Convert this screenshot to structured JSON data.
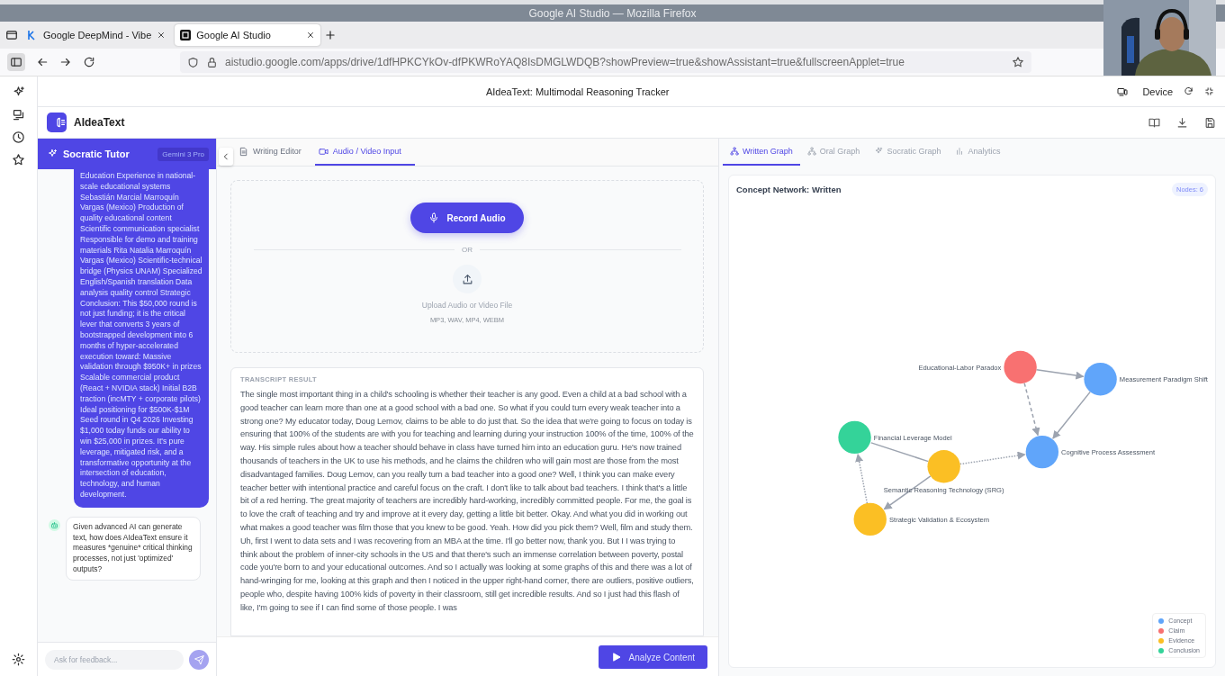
{
  "browser": {
    "window_title": "Google AI Studio — Mozilla Firefox",
    "tabs": [
      {
        "label": "Google DeepMind - Vibe",
        "selected": false
      },
      {
        "label": "Google AI Studio",
        "selected": true
      }
    ],
    "url": "aistudio.google.com/apps/drive/1dfHPKCYkOv-dfPKWRoYAQ8IsDMGLWDQB?showPreview=true&showAssistant=true&fullscreenApplet=true"
  },
  "applet": {
    "title": "AIdeaText: Multimodal Reasoning Tracker",
    "device_label": "Device"
  },
  "app": {
    "name": "AIdeaText"
  },
  "tutor": {
    "title": "Socratic Tutor",
    "model": "Gemini 3 Pro",
    "messages": [
      {
        "kind": "user",
        "text": "Education Experience in national-scale educational systems Sebastián Marcial Marroquín Vargas (Mexico) Production of quality educational content Scientific communication specialist Responsible for demo and training materials Rita Natalia Marroquín Vargas (Mexico) Scientific-technical bridge (Physics UNAM) Specialized English/Spanish translation Data analysis quality control Strategic Conclusion: This $50,000 round is not just funding; it is the critical lever that converts 3 years of bootstrapped development into 6 months of hyper-accelerated execution toward: Massive validation through $950K+ in prizes Scalable commercial product (React + NVIDIA stack) Initial B2B traction (incMTY + corporate pilots) Ideal positioning for $500K-$1M Seed round in Q4 2026 Investing $1,000 today funds our ability to win $25,000 in prizes. It's pure leverage, mitigated risk, and a transformative opportunity at the intersection of education, technology, and human development."
      },
      {
        "kind": "assistant",
        "text": "Given advanced AI can generate text, how does AIdeaText ensure it measures *genuine* critical thinking processes, not just 'optimized' outputs?"
      }
    ],
    "input_placeholder": "Ask for feedback..."
  },
  "input_tabs": [
    {
      "label": "Writing Editor",
      "selected": false
    },
    {
      "label": "Audio / Video Input",
      "selected": true
    }
  ],
  "recorder": {
    "record_label": "Record Audio",
    "divider": "OR",
    "upload_label": "Upload Audio or Video File",
    "formats": "MP3, WAV, MP4, WEBM"
  },
  "transcript": {
    "heading": "TRANSCRIPT RESULT",
    "text": "The single most important thing in a child's schooling is whether their teacher is any good. Even a child at a bad school with a good teacher can learn more than one at a good school with a bad one. So what if you could turn every weak teacher into a strong one? My educator today, Doug Lemov, claims to be able to do just that. So the idea that we're going to focus on today is ensuring that 100% of the students are with you for teaching and learning during your instruction 100% of the time, 100% of the way. His simple rules about how a teacher should behave in class have turned him into an education guru. He's now trained thousands of teachers in the UK to use his methods, and he claims the children who will gain most are those from the most disadvantaged families. Doug Lemov, can you really turn a bad teacher into a good one? Well, I think you can make every teacher better with intentional practice and careful focus on the craft. I don't like to talk about bad teachers. I think that's a little bit of a red herring. The great majority of teachers are incredibly hard-working, incredibly committed people. For me, the goal is to love the craft of teaching and try and improve at it every day, getting a little bit better. Okay. And what you did in working out what makes a good teacher was film those that you knew to be good. Yeah. How did you pick them? Well, film and study them. Uh, first I went to data sets and I was recovering from an MBA at the time. I'll go better now, thank you. But I I was trying to think about the problem of inner-city schools in the US and that there's such an immense correlation between poverty, postal code you're born to and your educational outcomes. And so I actually was looking at some graphs of this and there was a lot of hand-wringing for me, looking at this graph and then I noticed in the upper right-hand corner, there are outliers, positive outliers, people who, despite having 100% kids of poverty in their classroom, still get incredible results. And so I just had this flash of like, I'm going to see if I can find some of those people. I was"
  },
  "analyze_label": "Analyze Content",
  "graph_tabs": [
    {
      "label": "Written Graph",
      "selected": true
    },
    {
      "label": "Oral Graph",
      "selected": false
    },
    {
      "label": "Socratic Graph",
      "selected": false
    },
    {
      "label": "Analytics",
      "selected": false
    }
  ],
  "graph": {
    "title": "Concept Network: Written",
    "count": "Nodes: 6",
    "nodes": [
      {
        "label": "Educational-Labor Paradox",
        "kind": "claim"
      },
      {
        "label": "Measurement Paradigm Shift",
        "kind": "concept"
      },
      {
        "label": "Financial Leverage Model",
        "kind": "conclusion"
      },
      {
        "label": "Cognitive Process Assessment",
        "kind": "concept"
      },
      {
        "label": "Semantic Reasoning Technology (SRG)",
        "kind": "evidence"
      },
      {
        "label": "Strategic Validation & Ecosystem",
        "kind": "evidence"
      }
    ],
    "legend": [
      {
        "label": "Concept",
        "kind": "concept",
        "color": "#60a5fa"
      },
      {
        "label": "Claim",
        "kind": "claim",
        "color": "#f87171"
      },
      {
        "label": "Evidence",
        "kind": "evidence",
        "color": "#fbbf24"
      },
      {
        "label": "Conclusion",
        "kind": "conclusion",
        "color": "#34d399"
      }
    ]
  }
}
